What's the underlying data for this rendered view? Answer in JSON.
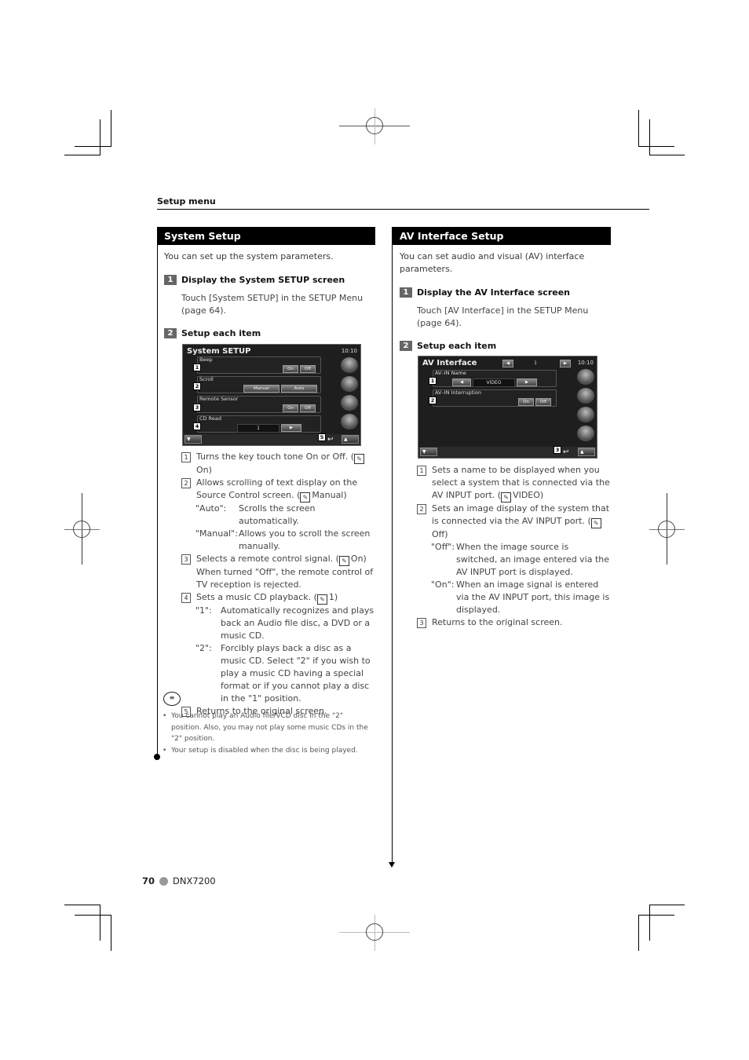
{
  "header": {
    "section_label": "Setup menu"
  },
  "system_setup": {
    "title": "System Setup",
    "intro": "You can set up the system parameters.",
    "steps": [
      {
        "num": "1",
        "title": "Display the System SETUP screen",
        "body": "Touch [System SETUP] in the SETUP Menu (page 64)."
      },
      {
        "num": "2",
        "title": "Setup each item"
      }
    ],
    "screen": {
      "title": "System SETUP",
      "time": "10:10",
      "rows": [
        {
          "num": "1",
          "label": "Beep",
          "buttons": [
            "On",
            "Off"
          ]
        },
        {
          "num": "2",
          "label": "Scroll",
          "buttons": [
            "Manual",
            "Auto"
          ]
        },
        {
          "num": "3",
          "label": "Remote Sensor",
          "buttons": [
            "On",
            "Off"
          ]
        },
        {
          "num": "4",
          "label": "CD Read",
          "value": "1",
          "arrow": "▶"
        }
      ],
      "back_num": "5",
      "back_icon": "↩",
      "down_btn": "▼",
      "up_btn": "▲"
    },
    "descriptions": [
      {
        "num": "1",
        "text": "Turns the key touch tone On or Off. (",
        "default": "On)"
      },
      {
        "num": "2",
        "text": "Allows scrolling of text display on the Source Control screen. (",
        "default": "Manual)",
        "subs": [
          {
            "key": "\"Auto\":",
            "text": "Scrolls the screen automatically."
          },
          {
            "key": "\"Manual\":",
            "text": "Allows you to scroll the screen manually."
          }
        ]
      },
      {
        "num": "3",
        "text": "Selects a remote control signal. (",
        "default": "On)",
        "extra": "When turned \"Off\", the remote control of TV reception is rejected."
      },
      {
        "num": "4",
        "text": "Sets a music CD playback. (",
        "default": "1)",
        "subs": [
          {
            "key": "\"1\":",
            "text": "Automatically recognizes and plays back an Audio file disc, a DVD or a music CD."
          },
          {
            "key": "\"2\":",
            "text": "Forcibly plays back a disc as a music CD. Select \"2\" if you wish to play a music CD having a special format or if you cannot play a disc in the \"1\" position."
          }
        ]
      },
      {
        "num": "5",
        "text": "Returns to the original screen."
      }
    ],
    "notes_icon": "note-icon",
    "notes": [
      "You cannot play an Audio file/VCD disc in the \"2\" position. Also, you may not play some music CDs in the \"2\" position.",
      "Your setup is disabled when the disc is being played."
    ]
  },
  "av_setup": {
    "title": "AV Interface Setup",
    "intro": "You can set audio and visual (AV) interface parameters.",
    "steps": [
      {
        "num": "1",
        "title": "Display the AV Interface screen",
        "body": "Touch [AV Interface] in the SETUP Menu (page 64)."
      },
      {
        "num": "2",
        "title": "Setup each item"
      }
    ],
    "screen": {
      "title": "AV Interface",
      "time": "10:10",
      "page": "1",
      "rows": [
        {
          "num": "1",
          "label": "AV–IN Name",
          "value": "VIDEO",
          "left_arrow": "◀",
          "right_arrow": "▶"
        },
        {
          "num": "2",
          "label": "AV–IN Interruption",
          "buttons": [
            "On",
            "Off"
          ]
        }
      ],
      "back_num": "3",
      "back_icon": "↩",
      "down_btn": "▼",
      "up_btn": "▲"
    },
    "descriptions": [
      {
        "num": "1",
        "text": "Sets a name to be displayed when you select a system that is connected via the AV INPUT port. (",
        "default": "VIDEO)"
      },
      {
        "num": "2",
        "text": "Sets an image display of the system that is connected via the AV INPUT port. (",
        "default": "Off)",
        "subs": [
          {
            "key": "\"Off\":",
            "text": "When the image source is switched, an image entered via the AV INPUT port is displayed."
          },
          {
            "key": "\"On\":",
            "text": "When an image signal is entered via the AV INPUT port, this image is displayed."
          }
        ]
      },
      {
        "num": "3",
        "text": "Returns to the original screen."
      }
    ]
  },
  "footer": {
    "page": "70",
    "model": "DNX7200"
  },
  "icons": {
    "wrench": "✎",
    "note": "≡"
  }
}
